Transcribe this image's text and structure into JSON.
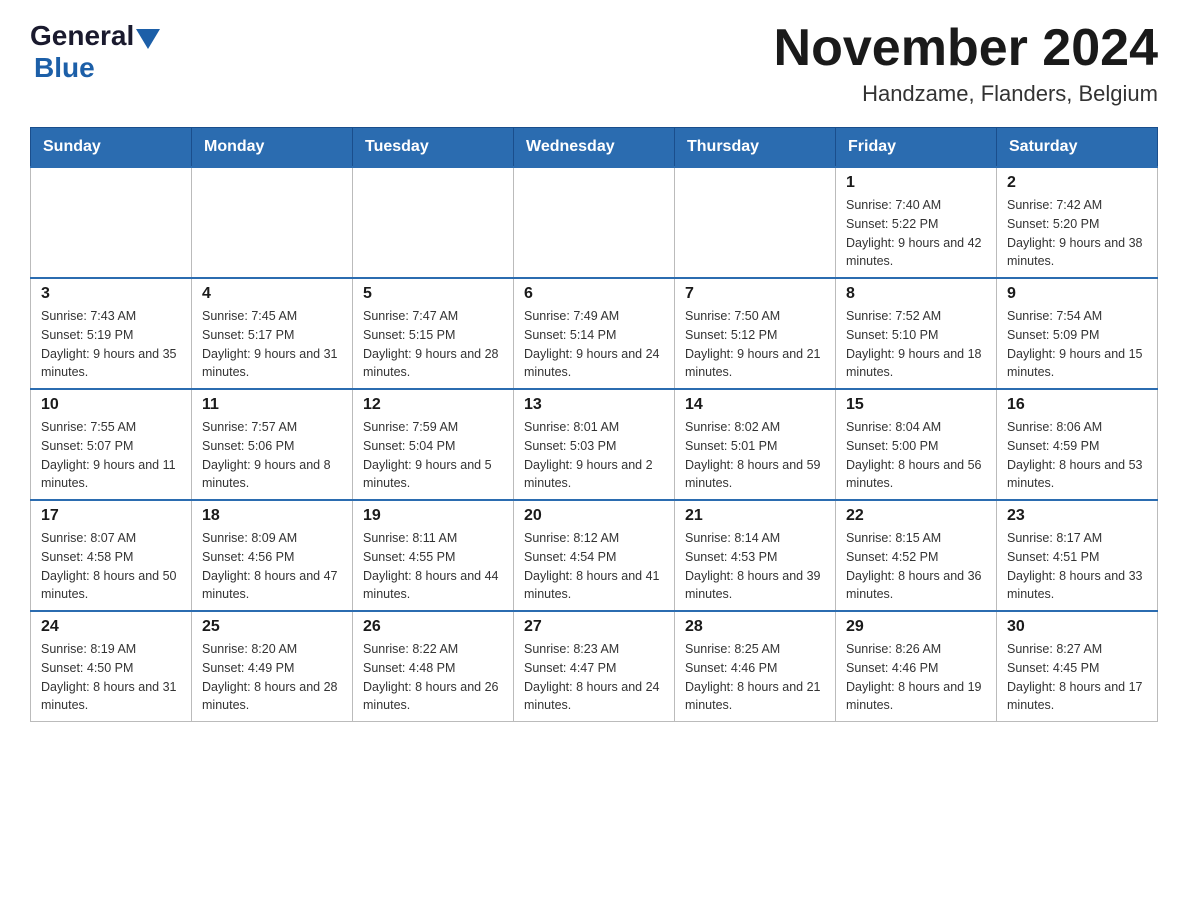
{
  "logo": {
    "general": "General",
    "blue": "Blue"
  },
  "title": "November 2024",
  "subtitle": "Handzame, Flanders, Belgium",
  "weekdays": [
    "Sunday",
    "Monday",
    "Tuesday",
    "Wednesday",
    "Thursday",
    "Friday",
    "Saturday"
  ],
  "weeks": [
    [
      {
        "day": "",
        "sunrise": "",
        "sunset": "",
        "daylight": ""
      },
      {
        "day": "",
        "sunrise": "",
        "sunset": "",
        "daylight": ""
      },
      {
        "day": "",
        "sunrise": "",
        "sunset": "",
        "daylight": ""
      },
      {
        "day": "",
        "sunrise": "",
        "sunset": "",
        "daylight": ""
      },
      {
        "day": "",
        "sunrise": "",
        "sunset": "",
        "daylight": ""
      },
      {
        "day": "1",
        "sunrise": "Sunrise: 7:40 AM",
        "sunset": "Sunset: 5:22 PM",
        "daylight": "Daylight: 9 hours and 42 minutes."
      },
      {
        "day": "2",
        "sunrise": "Sunrise: 7:42 AM",
        "sunset": "Sunset: 5:20 PM",
        "daylight": "Daylight: 9 hours and 38 minutes."
      }
    ],
    [
      {
        "day": "3",
        "sunrise": "Sunrise: 7:43 AM",
        "sunset": "Sunset: 5:19 PM",
        "daylight": "Daylight: 9 hours and 35 minutes."
      },
      {
        "day": "4",
        "sunrise": "Sunrise: 7:45 AM",
        "sunset": "Sunset: 5:17 PM",
        "daylight": "Daylight: 9 hours and 31 minutes."
      },
      {
        "day": "5",
        "sunrise": "Sunrise: 7:47 AM",
        "sunset": "Sunset: 5:15 PM",
        "daylight": "Daylight: 9 hours and 28 minutes."
      },
      {
        "day": "6",
        "sunrise": "Sunrise: 7:49 AM",
        "sunset": "Sunset: 5:14 PM",
        "daylight": "Daylight: 9 hours and 24 minutes."
      },
      {
        "day": "7",
        "sunrise": "Sunrise: 7:50 AM",
        "sunset": "Sunset: 5:12 PM",
        "daylight": "Daylight: 9 hours and 21 minutes."
      },
      {
        "day": "8",
        "sunrise": "Sunrise: 7:52 AM",
        "sunset": "Sunset: 5:10 PM",
        "daylight": "Daylight: 9 hours and 18 minutes."
      },
      {
        "day": "9",
        "sunrise": "Sunrise: 7:54 AM",
        "sunset": "Sunset: 5:09 PM",
        "daylight": "Daylight: 9 hours and 15 minutes."
      }
    ],
    [
      {
        "day": "10",
        "sunrise": "Sunrise: 7:55 AM",
        "sunset": "Sunset: 5:07 PM",
        "daylight": "Daylight: 9 hours and 11 minutes."
      },
      {
        "day": "11",
        "sunrise": "Sunrise: 7:57 AM",
        "sunset": "Sunset: 5:06 PM",
        "daylight": "Daylight: 9 hours and 8 minutes."
      },
      {
        "day": "12",
        "sunrise": "Sunrise: 7:59 AM",
        "sunset": "Sunset: 5:04 PM",
        "daylight": "Daylight: 9 hours and 5 minutes."
      },
      {
        "day": "13",
        "sunrise": "Sunrise: 8:01 AM",
        "sunset": "Sunset: 5:03 PM",
        "daylight": "Daylight: 9 hours and 2 minutes."
      },
      {
        "day": "14",
        "sunrise": "Sunrise: 8:02 AM",
        "sunset": "Sunset: 5:01 PM",
        "daylight": "Daylight: 8 hours and 59 minutes."
      },
      {
        "day": "15",
        "sunrise": "Sunrise: 8:04 AM",
        "sunset": "Sunset: 5:00 PM",
        "daylight": "Daylight: 8 hours and 56 minutes."
      },
      {
        "day": "16",
        "sunrise": "Sunrise: 8:06 AM",
        "sunset": "Sunset: 4:59 PM",
        "daylight": "Daylight: 8 hours and 53 minutes."
      }
    ],
    [
      {
        "day": "17",
        "sunrise": "Sunrise: 8:07 AM",
        "sunset": "Sunset: 4:58 PM",
        "daylight": "Daylight: 8 hours and 50 minutes."
      },
      {
        "day": "18",
        "sunrise": "Sunrise: 8:09 AM",
        "sunset": "Sunset: 4:56 PM",
        "daylight": "Daylight: 8 hours and 47 minutes."
      },
      {
        "day": "19",
        "sunrise": "Sunrise: 8:11 AM",
        "sunset": "Sunset: 4:55 PM",
        "daylight": "Daylight: 8 hours and 44 minutes."
      },
      {
        "day": "20",
        "sunrise": "Sunrise: 8:12 AM",
        "sunset": "Sunset: 4:54 PM",
        "daylight": "Daylight: 8 hours and 41 minutes."
      },
      {
        "day": "21",
        "sunrise": "Sunrise: 8:14 AM",
        "sunset": "Sunset: 4:53 PM",
        "daylight": "Daylight: 8 hours and 39 minutes."
      },
      {
        "day": "22",
        "sunrise": "Sunrise: 8:15 AM",
        "sunset": "Sunset: 4:52 PM",
        "daylight": "Daylight: 8 hours and 36 minutes."
      },
      {
        "day": "23",
        "sunrise": "Sunrise: 8:17 AM",
        "sunset": "Sunset: 4:51 PM",
        "daylight": "Daylight: 8 hours and 33 minutes."
      }
    ],
    [
      {
        "day": "24",
        "sunrise": "Sunrise: 8:19 AM",
        "sunset": "Sunset: 4:50 PM",
        "daylight": "Daylight: 8 hours and 31 minutes."
      },
      {
        "day": "25",
        "sunrise": "Sunrise: 8:20 AM",
        "sunset": "Sunset: 4:49 PM",
        "daylight": "Daylight: 8 hours and 28 minutes."
      },
      {
        "day": "26",
        "sunrise": "Sunrise: 8:22 AM",
        "sunset": "Sunset: 4:48 PM",
        "daylight": "Daylight: 8 hours and 26 minutes."
      },
      {
        "day": "27",
        "sunrise": "Sunrise: 8:23 AM",
        "sunset": "Sunset: 4:47 PM",
        "daylight": "Daylight: 8 hours and 24 minutes."
      },
      {
        "day": "28",
        "sunrise": "Sunrise: 8:25 AM",
        "sunset": "Sunset: 4:46 PM",
        "daylight": "Daylight: 8 hours and 21 minutes."
      },
      {
        "day": "29",
        "sunrise": "Sunrise: 8:26 AM",
        "sunset": "Sunset: 4:46 PM",
        "daylight": "Daylight: 8 hours and 19 minutes."
      },
      {
        "day": "30",
        "sunrise": "Sunrise: 8:27 AM",
        "sunset": "Sunset: 4:45 PM",
        "daylight": "Daylight: 8 hours and 17 minutes."
      }
    ]
  ]
}
